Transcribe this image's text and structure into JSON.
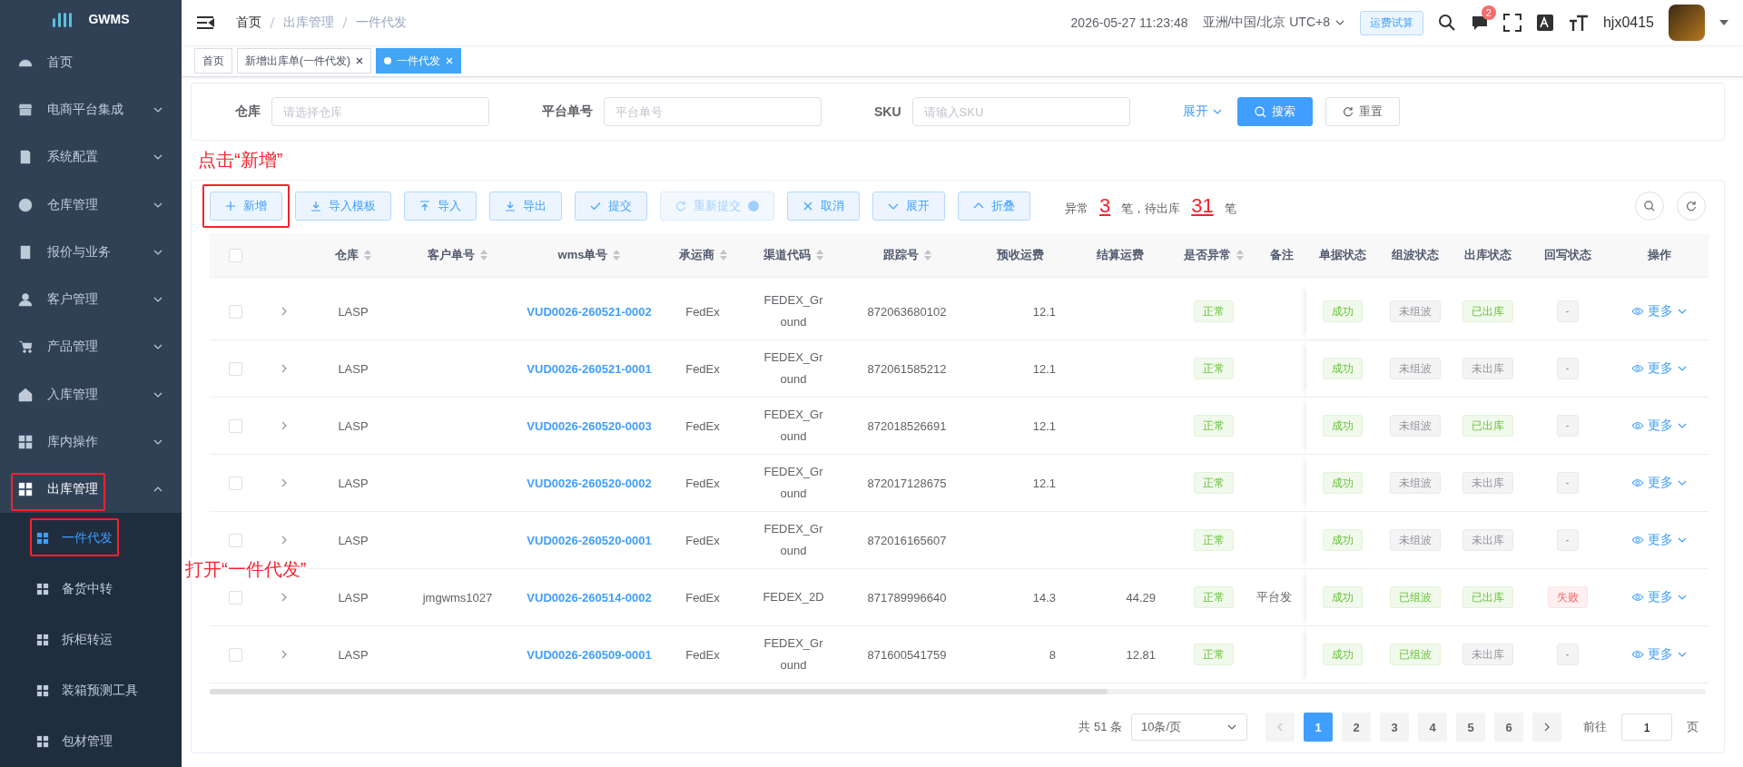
{
  "sidebar": {
    "logo": "GWMS",
    "items": [
      {
        "label": "首页",
        "kind": "link",
        "expanded": false,
        "highlighted": false
      },
      {
        "label": "电商平台集成",
        "kind": "group",
        "expanded": false,
        "highlighted": false
      },
      {
        "label": "系统配置",
        "kind": "group",
        "expanded": false,
        "highlighted": false
      },
      {
        "label": "仓库管理",
        "kind": "group",
        "expanded": false,
        "highlighted": false
      },
      {
        "label": "报价与业务",
        "kind": "group",
        "expanded": false,
        "highlighted": false
      },
      {
        "label": "客户管理",
        "kind": "group",
        "expanded": false,
        "highlighted": false
      },
      {
        "label": "产品管理",
        "kind": "group",
        "expanded": false,
        "highlighted": false
      },
      {
        "label": "入库管理",
        "kind": "group",
        "expanded": false,
        "highlighted": false
      },
      {
        "label": "库内操作",
        "kind": "group",
        "expanded": false,
        "highlighted": false
      },
      {
        "label": "出库管理",
        "kind": "group",
        "expanded": true,
        "highlighted": true,
        "children": [
          {
            "label": "一件代发",
            "selected": true,
            "highlighted": true
          },
          {
            "label": "备货中转",
            "selected": false,
            "highlighted": false
          },
          {
            "label": "拆柜转运",
            "selected": false,
            "highlighted": false
          },
          {
            "label": "装箱预测工具",
            "selected": false,
            "highlighted": false
          },
          {
            "label": "包材管理",
            "selected": false,
            "highlighted": false
          }
        ]
      }
    ]
  },
  "header": {
    "breadcrumb": [
      "首页",
      "出库管理",
      "一件代发"
    ],
    "datetime": "2026-05-27 11:23:48",
    "timezone": "亚洲/中国/北京 UTC+8",
    "calc_button": "运费试算",
    "message_badge": "2",
    "username": "hjx0415"
  },
  "tags": [
    {
      "label": "首页",
      "selected": false,
      "closable": false
    },
    {
      "label": "新增出库单(一件代发)",
      "selected": false,
      "closable": true
    },
    {
      "label": "一件代发",
      "selected": true,
      "closable": true
    }
  ],
  "search": {
    "fields": [
      {
        "label": "仓库",
        "placeholder": "请选择仓库"
      },
      {
        "label": "平台单号",
        "placeholder": "平台单号"
      },
      {
        "label": "SKU",
        "placeholder": "请输入SKU"
      }
    ],
    "expand_link": "展开",
    "search_button": "搜索",
    "reset_button": "重置"
  },
  "annotations": [
    {
      "text": "点击“新增”"
    },
    {
      "text": "打开“一件代发”"
    }
  ],
  "toolbar": {
    "buttons": [
      {
        "label": "新增",
        "kind": "plus",
        "disabled": false,
        "highlighted": true
      },
      {
        "label": "导入模板",
        "kind": "download",
        "disabled": false,
        "highlighted": false
      },
      {
        "label": "导入",
        "kind": "upload",
        "disabled": false,
        "highlighted": false
      },
      {
        "label": "导出",
        "kind": "download",
        "disabled": false,
        "highlighted": false
      },
      {
        "label": "提交",
        "kind": "check",
        "disabled": false,
        "highlighted": false
      },
      {
        "label": "重新提交",
        "kind": "refresh",
        "disabled": true,
        "highlighted": false
      },
      {
        "label": "取消",
        "kind": "close",
        "disabled": false,
        "highlighted": false
      },
      {
        "label": "展开",
        "kind": "down",
        "disabled": false,
        "highlighted": false
      },
      {
        "label": "折叠",
        "kind": "up",
        "disabled": false,
        "highlighted": false
      }
    ],
    "summary": [
      {
        "kind": "text",
        "text": "异常"
      },
      {
        "kind": "number",
        "text": "3"
      },
      {
        "kind": "text",
        "text": "笔，待出库"
      },
      {
        "kind": "number",
        "text": "31"
      },
      {
        "kind": "text",
        "text": "笔"
      }
    ]
  },
  "table": {
    "select_all_checked": false,
    "columns": [
      {
        "label": "仓库",
        "sortable": true
      },
      {
        "label": "客户单号",
        "sortable": true
      },
      {
        "label": "wms单号",
        "sortable": true
      },
      {
        "label": "承运商",
        "sortable": true
      },
      {
        "label": "渠道代码",
        "sortable": true
      },
      {
        "label": "跟踪号",
        "sortable": true
      },
      {
        "label": "预收运费",
        "sortable": false
      },
      {
        "label": "结算运费",
        "sortable": false
      },
      {
        "label": "是否异常",
        "sortable": true
      },
      {
        "label": "备注",
        "sortable": false
      },
      {
        "label": "单据状态",
        "sortable": false
      },
      {
        "label": "组波状态",
        "sortable": false
      },
      {
        "label": "出库状态",
        "sortable": false
      },
      {
        "label": "回写状态",
        "sortable": false
      },
      {
        "label": "操作",
        "sortable": false
      }
    ],
    "rows": [
      {
        "selected": false,
        "warehouse": "LASP",
        "wms_no": "VUD0026-260521-0002",
        "carrier": "FedEx",
        "channel": "FEDEX_Ground",
        "tracking": "872063680102",
        "est_fee": "12.1",
        "abnormal": {
          "text": "正常",
          "kind": "success"
        },
        "doc_status": {
          "text": "成功",
          "kind": "success"
        },
        "wave_status": {
          "text": "未组波",
          "kind": "info"
        },
        "out_status": {
          "text": "已出库",
          "kind": "success"
        },
        "writeback": {
          "text": "-",
          "kind": "info"
        },
        "action": "更多"
      },
      {
        "selected": false,
        "warehouse": "LASP",
        "wms_no": "VUD0026-260521-0001",
        "carrier": "FedEx",
        "channel": "FEDEX_Ground",
        "tracking": "872061585212",
        "est_fee": "12.1",
        "abnormal": {
          "text": "正常",
          "kind": "success"
        },
        "doc_status": {
          "text": "成功",
          "kind": "success"
        },
        "wave_status": {
          "text": "未组波",
          "kind": "info"
        },
        "out_status": {
          "text": "未出库",
          "kind": "info"
        },
        "writeback": {
          "text": "-",
          "kind": "info"
        },
        "action": "更多"
      },
      {
        "selected": false,
        "warehouse": "LASP",
        "wms_no": "VUD0026-260520-0003",
        "carrier": "FedEx",
        "channel": "FEDEX_Ground",
        "tracking": "872018526691",
        "est_fee": "12.1",
        "abnormal": {
          "text": "正常",
          "kind": "success"
        },
        "doc_status": {
          "text": "成功",
          "kind": "success"
        },
        "wave_status": {
          "text": "未组波",
          "kind": "info"
        },
        "out_status": {
          "text": "已出库",
          "kind": "success"
        },
        "writeback": {
          "text": "-",
          "kind": "info"
        },
        "action": "更多"
      },
      {
        "selected": false,
        "warehouse": "LASP",
        "wms_no": "VUD0026-260520-0002",
        "carrier": "FedEx",
        "channel": "FEDEX_Ground",
        "tracking": "872017128675",
        "est_fee": "12.1",
        "abnormal": {
          "text": "正常",
          "kind": "success"
        },
        "doc_status": {
          "text": "成功",
          "kind": "success"
        },
        "wave_status": {
          "text": "未组波",
          "kind": "info"
        },
        "out_status": {
          "text": "未出库",
          "kind": "info"
        },
        "writeback": {
          "text": "-",
          "kind": "info"
        },
        "action": "更多"
      },
      {
        "selected": false,
        "warehouse": "LASP",
        "wms_no": "VUD0026-260520-0001",
        "carrier": "FedEx",
        "channel": "FEDEX_Ground",
        "tracking": "872016165607",
        "abnormal": {
          "text": "正常",
          "kind": "success"
        },
        "doc_status": {
          "text": "成功",
          "kind": "success"
        },
        "wave_status": {
          "text": "未组波",
          "kind": "info"
        },
        "out_status": {
          "text": "未出库",
          "kind": "info"
        },
        "writeback": {
          "text": "-",
          "kind": "info"
        },
        "action": "更多"
      },
      {
        "selected": false,
        "warehouse": "LASP",
        "customer_no": "jmgwms1027",
        "wms_no": "VUD0026-260514-0002",
        "carrier": "FedEx",
        "channel": "FEDEX_2D",
        "tracking": "871789996640",
        "est_fee": "14.3",
        "settle_fee": "44.29",
        "abnormal": {
          "text": "正常",
          "kind": "success"
        },
        "remark": "平台发",
        "doc_status": {
          "text": "成功",
          "kind": "success"
        },
        "wave_status": {
          "text": "已组波",
          "kind": "success"
        },
        "out_status": {
          "text": "已出库",
          "kind": "success"
        },
        "writeback": {
          "text": "失败",
          "kind": "danger"
        },
        "action": "更多"
      },
      {
        "selected": false,
        "warehouse": "LASP",
        "wms_no": "VUD0026-260509-0001",
        "carrier": "FedEx",
        "channel": "FEDEX_Ground",
        "tracking": "871600541759",
        "est_fee": "8",
        "settle_fee": "12.81",
        "abnormal": {
          "text": "正常",
          "kind": "success"
        },
        "doc_status": {
          "text": "成功",
          "kind": "success"
        },
        "wave_status": {
          "text": "已组波",
          "kind": "success"
        },
        "out_status": {
          "text": "未出库",
          "kind": "info"
        },
        "writeback": {
          "text": "-",
          "kind": "info"
        },
        "action": "更多"
      }
    ]
  },
  "pagination": {
    "total": "共 51 条",
    "page_size": "10条/页",
    "prev_disabled": true,
    "pages": [
      {
        "label": "1",
        "selected": true
      },
      {
        "label": "2",
        "selected": false
      },
      {
        "label": "3",
        "selected": false
      },
      {
        "label": "4",
        "selected": false
      },
      {
        "label": "5",
        "selected": false
      },
      {
        "label": "6",
        "selected": false
      }
    ],
    "jump_label": "前往",
    "jump_value": "1",
    "jump_suffix": "页"
  }
}
